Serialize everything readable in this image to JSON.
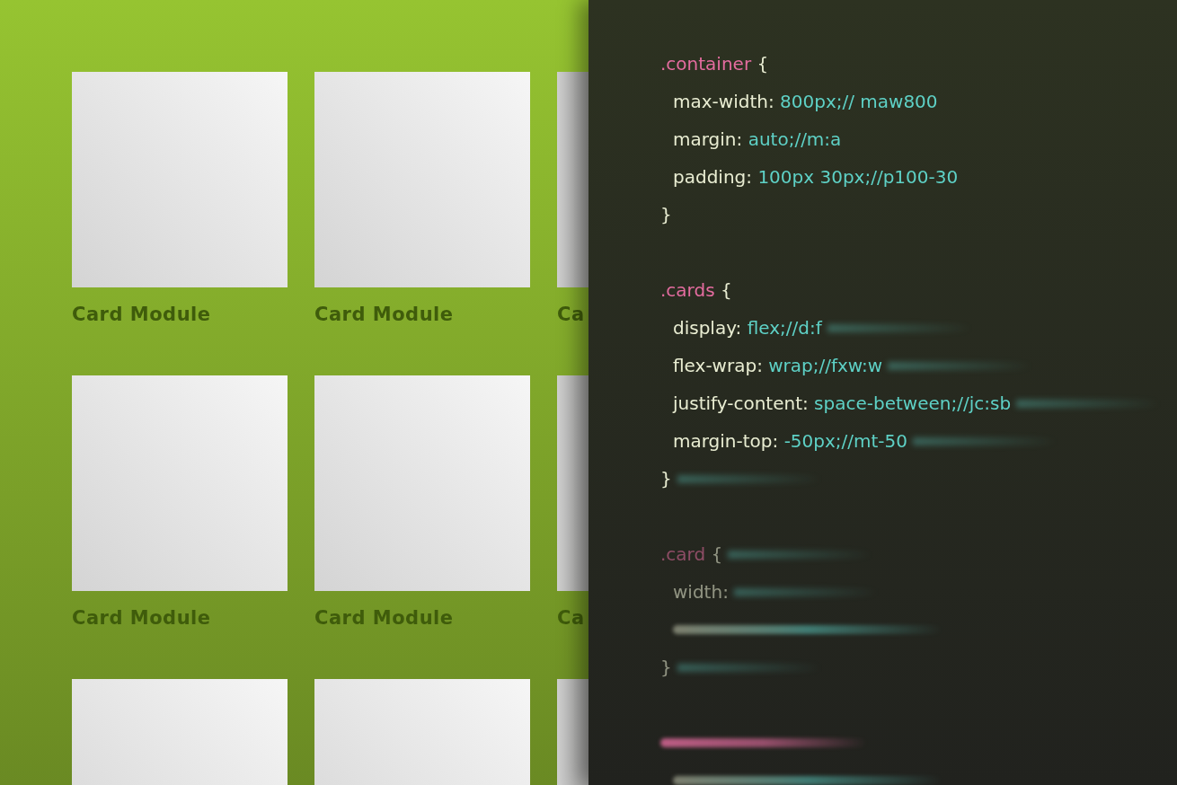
{
  "card_grid": {
    "rows": [
      {
        "cards": [
          {
            "kind": "card",
            "label": "Card Module"
          },
          {
            "kind": "card",
            "label": "Card Module"
          },
          {
            "kind": "cut_card",
            "label": "Ca"
          }
        ]
      },
      {
        "cards": [
          {
            "kind": "card",
            "label": "Card Module"
          },
          {
            "kind": "card",
            "label": "Card Module"
          },
          {
            "kind": "cut_card",
            "label": "Ca"
          }
        ]
      },
      {
        "cards": [
          {
            "kind": "card"
          },
          {
            "kind": "card"
          },
          {
            "kind": "cut_card"
          }
        ]
      }
    ]
  },
  "code_editor": {
    "lines": [
      {
        "kind": "plain",
        "indent": false,
        "tokens": [
          {
            "kind": "selector",
            "text": ".container"
          },
          {
            "kind": "brace",
            "text": " {"
          }
        ]
      },
      {
        "kind": "plain",
        "indent": true,
        "tokens": [
          {
            "kind": "property",
            "text": "max-width: "
          },
          {
            "kind": "value",
            "text": "800px;// maw800"
          }
        ]
      },
      {
        "kind": "plain",
        "indent": true,
        "tokens": [
          {
            "kind": "property",
            "text": "margin: "
          },
          {
            "kind": "value",
            "text": "auto;//m:a"
          }
        ]
      },
      {
        "kind": "plain",
        "indent": true,
        "tokens": [
          {
            "kind": "property",
            "text": "padding: "
          },
          {
            "kind": "value",
            "text": "100px 30px;//p100-30"
          }
        ]
      },
      {
        "kind": "plain",
        "indent": false,
        "tokens": [
          {
            "kind": "brace",
            "text": "}"
          }
        ]
      },
      {
        "kind": "blank"
      },
      {
        "kind": "plain",
        "indent": false,
        "tokens": [
          {
            "kind": "selector",
            "text": ".cards"
          },
          {
            "kind": "brace",
            "text": " {"
          }
        ]
      },
      {
        "kind": "streaked",
        "indent": true,
        "tokens": [
          {
            "kind": "property",
            "text": "display: "
          },
          {
            "kind": "value",
            "text": "flex;//d:f"
          }
        ]
      },
      {
        "kind": "streaked",
        "indent": true,
        "tokens": [
          {
            "kind": "property",
            "text": "flex-wrap: "
          },
          {
            "kind": "value",
            "text": "wrap;//fxw:w"
          }
        ]
      },
      {
        "kind": "streaked",
        "indent": true,
        "tokens": [
          {
            "kind": "property",
            "text": "justify-content: "
          },
          {
            "kind": "value",
            "text": "space-between;//jc:sb"
          }
        ]
      },
      {
        "kind": "streaked",
        "indent": true,
        "tokens": [
          {
            "kind": "property",
            "text": "margin-top: "
          },
          {
            "kind": "value",
            "text": "-50px;//mt-50"
          }
        ]
      },
      {
        "kind": "streaked",
        "indent": false,
        "tokens": [
          {
            "kind": "brace",
            "text": "}"
          }
        ]
      },
      {
        "kind": "blank"
      },
      {
        "kind": "faded",
        "indent": false,
        "tokens": [
          {
            "kind": "selector",
            "text": ".card"
          },
          {
            "kind": "brace",
            "text": " {"
          }
        ]
      },
      {
        "kind": "faded",
        "indent": true,
        "tokens": [
          {
            "kind": "property",
            "text": "width:"
          }
        ]
      },
      {
        "kind": "declaration_smear",
        "indent": true
      },
      {
        "kind": "faded",
        "indent": false,
        "tokens": [
          {
            "kind": "brace",
            "text": "}"
          }
        ]
      },
      {
        "kind": "blank"
      },
      {
        "kind": "selector_smear",
        "indent": false
      },
      {
        "kind": "declaration_smear",
        "indent": true
      }
    ]
  }
}
